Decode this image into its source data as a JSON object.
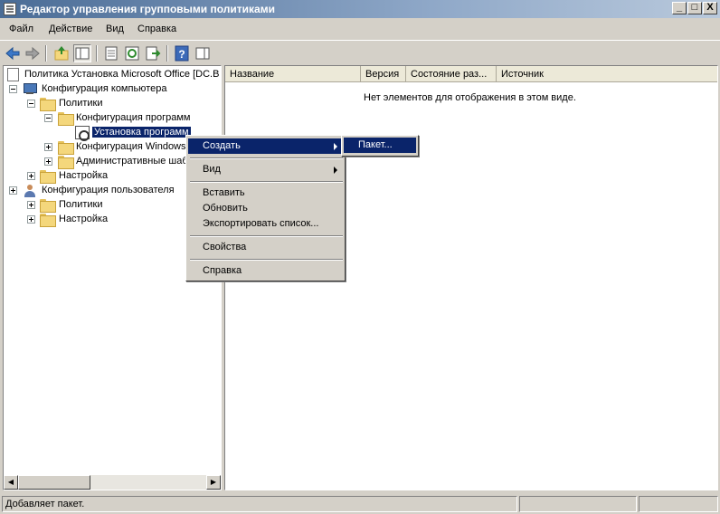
{
  "window": {
    "title": "Редактор управления групповыми политиками",
    "minimize": "_",
    "maximize": "□",
    "close": "X"
  },
  "menubar": [
    "Файл",
    "Действие",
    "Вид",
    "Справка"
  ],
  "toolbar": {
    "icons": [
      "back-icon",
      "forward-icon",
      "up-folder-icon",
      "show-hide-tree-icon",
      "properties-icon",
      "refresh-icon",
      "export-list-icon",
      "help-icon",
      "show-hide-action-pane-icon"
    ]
  },
  "tree": {
    "root": "Политика Установка Microsoft Office [DC.B",
    "items": [
      {
        "label": "Конфигурация компьютера"
      },
      {
        "label": "Политики"
      },
      {
        "label": "Конфигурация программ"
      },
      {
        "label": "Установка программ"
      },
      {
        "label": "Конфигурация Windows"
      },
      {
        "label": "Административные шаб"
      },
      {
        "label": "Настройка"
      },
      {
        "label": "Конфигурация пользователя"
      },
      {
        "label": "Политики"
      },
      {
        "label": "Настройка"
      }
    ]
  },
  "list": {
    "columns": [
      "Название",
      "Версия",
      "Состояние раз...",
      "Источник"
    ],
    "empty_message": "Нет элементов для отображения в этом виде."
  },
  "context_menu": {
    "items": [
      "Создать",
      "Вид",
      "Вставить",
      "Обновить",
      "Экспортировать список...",
      "Свойства",
      "Справка"
    ]
  },
  "submenu": {
    "items": [
      "Пакет..."
    ]
  },
  "statusbar": {
    "text": "Добавляет пакет."
  },
  "colors": {
    "selection": "#0a246a",
    "titlebar_start": "#4a6c96",
    "titlebar_end": "#b9c9dc"
  }
}
